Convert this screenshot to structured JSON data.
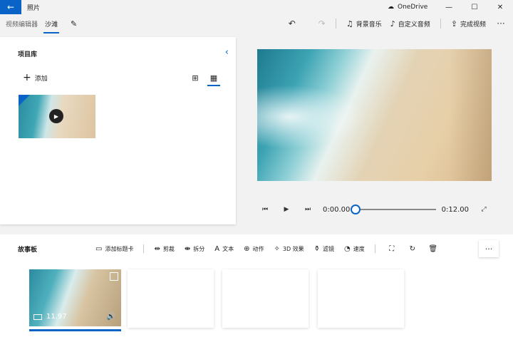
{
  "app": {
    "title": "照片",
    "onedrive": "OneDrive"
  },
  "window": {
    "minimize": "—",
    "maximize": "☐",
    "close": "✕"
  },
  "breadcrumb": {
    "parent": "视频编辑器",
    "current": "沙滩"
  },
  "toolbar": {
    "background_music": "背景音乐",
    "custom_audio": "自定义音频",
    "finish_video": "完成视频",
    "more": "···"
  },
  "library": {
    "title": "项目库",
    "add": "添加"
  },
  "playback": {
    "current_time": "0:00.00",
    "total_time": "0:12.00",
    "progress": 0
  },
  "storyboard": {
    "title": "故事板",
    "tools": [
      {
        "label": "添加标题卡",
        "icon": "title-card-icon"
      },
      {
        "label": "剪裁",
        "icon": "trim-icon"
      },
      {
        "label": "拆分",
        "icon": "split-icon"
      },
      {
        "label": "文本",
        "icon": "text-icon"
      },
      {
        "label": "动作",
        "icon": "motion-icon"
      },
      {
        "label": "3D 效果",
        "icon": "3d-effects-icon"
      },
      {
        "label": "滤镜",
        "icon": "filter-icon"
      },
      {
        "label": "速度",
        "icon": "speed-icon"
      }
    ],
    "more": "···",
    "clip": {
      "duration": "11.97"
    }
  },
  "colors": {
    "accent": "#0a64c8",
    "background": "#f2f2f2",
    "panel": "#ffffff"
  }
}
